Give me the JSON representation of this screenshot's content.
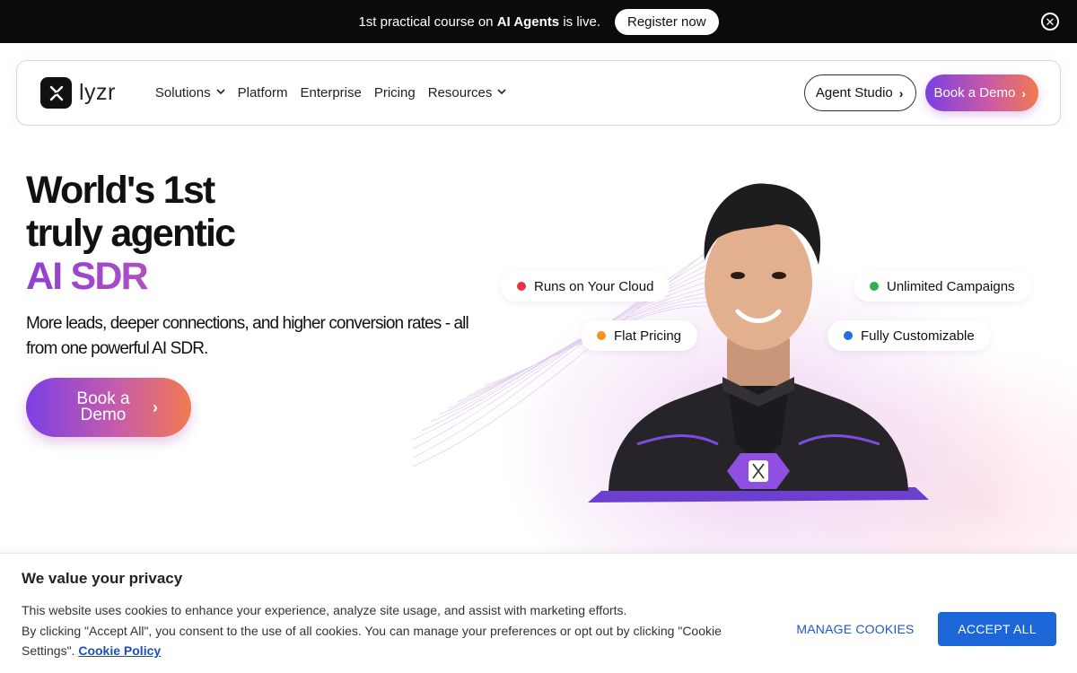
{
  "announcement": {
    "text_before": "1st practical course on ",
    "text_bold": "AI Agents",
    "text_after": " is live.",
    "register_label": "Register now",
    "close_icon": "close-circle-icon"
  },
  "navbar": {
    "logo_text": "lyzr",
    "menu": [
      {
        "label": "Solutions",
        "dropdown": true
      },
      {
        "label": "Platform",
        "dropdown": false
      },
      {
        "label": "Enterprise",
        "dropdown": false
      },
      {
        "label": "Pricing",
        "dropdown": false
      },
      {
        "label": "Resources",
        "dropdown": true
      }
    ],
    "agent_studio_label": "Agent Studio",
    "book_demo_label": "Book a Demo"
  },
  "hero": {
    "title_line1": "World's 1st",
    "title_line2": "truly agentic",
    "title_line3": "AI SDR",
    "subtitle": "More leads, deeper connections, and higher conversion rates - all from one powerful AI SDR.",
    "cta_label": "Book a Demo",
    "pills": [
      {
        "label": "Runs on Your Cloud",
        "color": "#e8334a"
      },
      {
        "label": "Flat Pricing",
        "color": "#f39422"
      },
      {
        "label": "Unlimited Campaigns",
        "color": "#2bb24c"
      },
      {
        "label": "Fully Customizable",
        "color": "#1f6fe0"
      }
    ]
  },
  "cookie": {
    "title": "We value your privacy",
    "line1": "This website uses cookies to enhance your experience, analyze site usage, and assist with marketing efforts.",
    "line2": "By clicking \"Accept All\", you consent to the use of all cookies. You can manage your preferences or opt out by clicking \"Cookie Settings\".",
    "policy_link": "Cookie Policy",
    "manage_label": "MANAGE COOKIES",
    "accept_label": "ACCEPT ALL"
  },
  "colors": {
    "brand_gradient_start": "#7b3fe4",
    "brand_gradient_end": "#f27a4f",
    "accept_blue": "#1d66d8"
  }
}
